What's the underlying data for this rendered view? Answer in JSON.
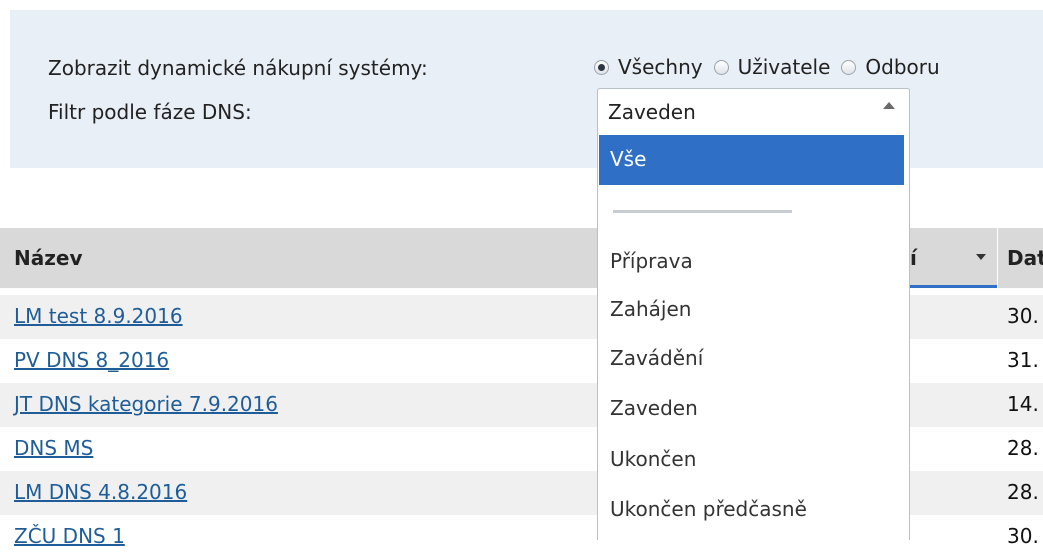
{
  "filters": {
    "show_label": "Zobrazit dynamické nákupní systémy:",
    "radios": [
      {
        "label": "Všechny",
        "checked": true
      },
      {
        "label": "Uživatele",
        "checked": false
      },
      {
        "label": "Odboru",
        "checked": false
      }
    ],
    "phase_label": "Filtr podle fáze DNS:",
    "phase_value": "Zaveden"
  },
  "dropdown": {
    "options": [
      "Vše",
      "Příprava",
      "Zahájen",
      "Zavádění",
      "Zaveden",
      "Ukončen",
      "Ukončen předčasně"
    ],
    "highlighted": "Vše"
  },
  "grid": {
    "columns": {
      "name": "Název",
      "partial": "í",
      "date": "Dat"
    },
    "rows": [
      {
        "name": "LM test 8.9.2016",
        "date": "30."
      },
      {
        "name": "PV DNS 8_2016",
        "date": "31."
      },
      {
        "name": "JT DNS kategorie 7.9.2016",
        "date": "14."
      },
      {
        "name": "DNS MS",
        "date": "28."
      },
      {
        "name": "LM DNS 4.8.2016",
        "date": "28."
      },
      {
        "name": "ZČU DNS 1",
        "date": "30."
      }
    ]
  },
  "colors": {
    "accent": "#2f6fc6",
    "panel": "#e9eff6",
    "link": "#1f5d99"
  }
}
